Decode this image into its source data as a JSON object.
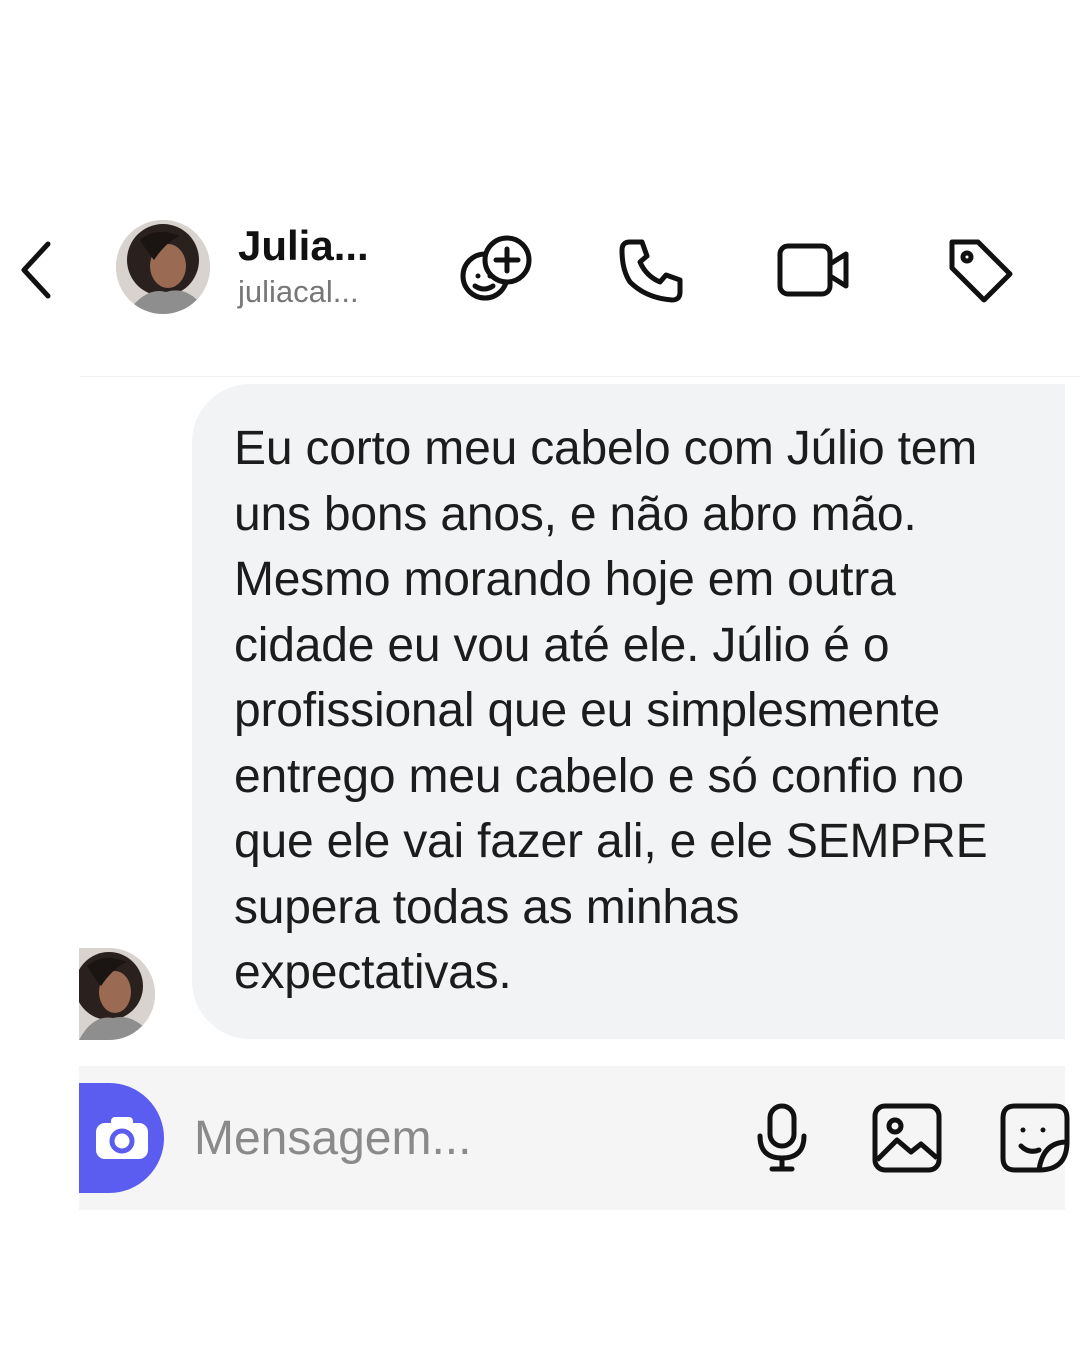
{
  "header": {
    "back_icon": "chevron-left-icon",
    "contact_name": "Julia...",
    "contact_username": "juliacal...",
    "actions": [
      {
        "name": "add-to-group",
        "icon": "add-people-icon"
      },
      {
        "name": "voice-call",
        "icon": "phone-icon"
      },
      {
        "name": "video-call",
        "icon": "video-camera-icon"
      },
      {
        "name": "label",
        "icon": "tag-icon"
      }
    ]
  },
  "message": {
    "lines": [
      "Eu corto meu cabelo com Júlio tem",
      "uns bons anos, e não abro mão.",
      "Mesmo morando hoje em outra",
      "cidade eu vou até ele. Júlio é o",
      "profissional que eu simplesmente",
      "entrego meu cabelo e só confio no",
      "que ele vai fazer ali, e ele SEMPRE",
      "supera todas as minhas",
      "expectativas."
    ]
  },
  "composer": {
    "placeholder": "Mensagem...",
    "camera_icon": "camera-icon",
    "mic_icon": "microphone-icon",
    "gallery_icon": "image-icon",
    "sticker_icon": "sticker-icon",
    "accent_color": "#5b5cf0"
  }
}
